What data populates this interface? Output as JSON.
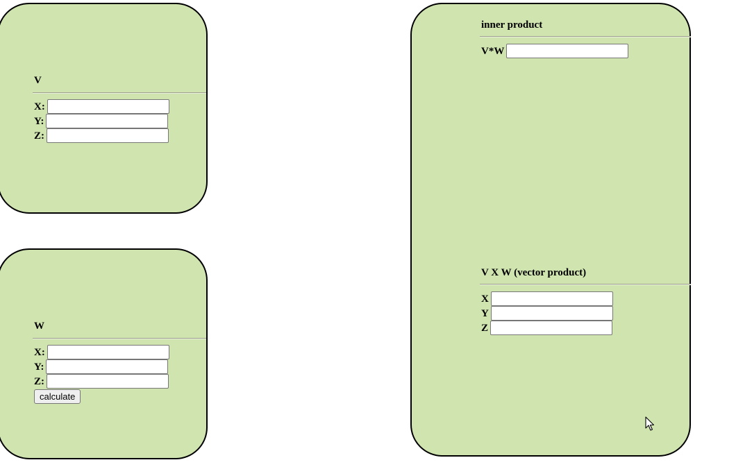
{
  "vector_v": {
    "title": "V",
    "fields": [
      {
        "label": "X:",
        "value": ""
      },
      {
        "label": "Y:",
        "value": ""
      },
      {
        "label": "Z:",
        "value": ""
      }
    ]
  },
  "vector_w": {
    "title": "W",
    "fields": [
      {
        "label": "X:",
        "value": ""
      },
      {
        "label": "Y:",
        "value": ""
      },
      {
        "label": "Z:",
        "value": ""
      }
    ],
    "calculate_label": "calculate"
  },
  "inner_product": {
    "title": "inner product",
    "label": "V*W",
    "value": ""
  },
  "vector_product": {
    "title": "V X W (vector product)",
    "fields": [
      {
        "label": "X",
        "value": ""
      },
      {
        "label": "Y",
        "value": ""
      },
      {
        "label": "Z",
        "value": ""
      }
    ]
  },
  "colors": {
    "panel_background": "#d0e4b0",
    "panel_border": "#000000"
  },
  "icons": {
    "cursor": "mouse-pointer-icon"
  }
}
